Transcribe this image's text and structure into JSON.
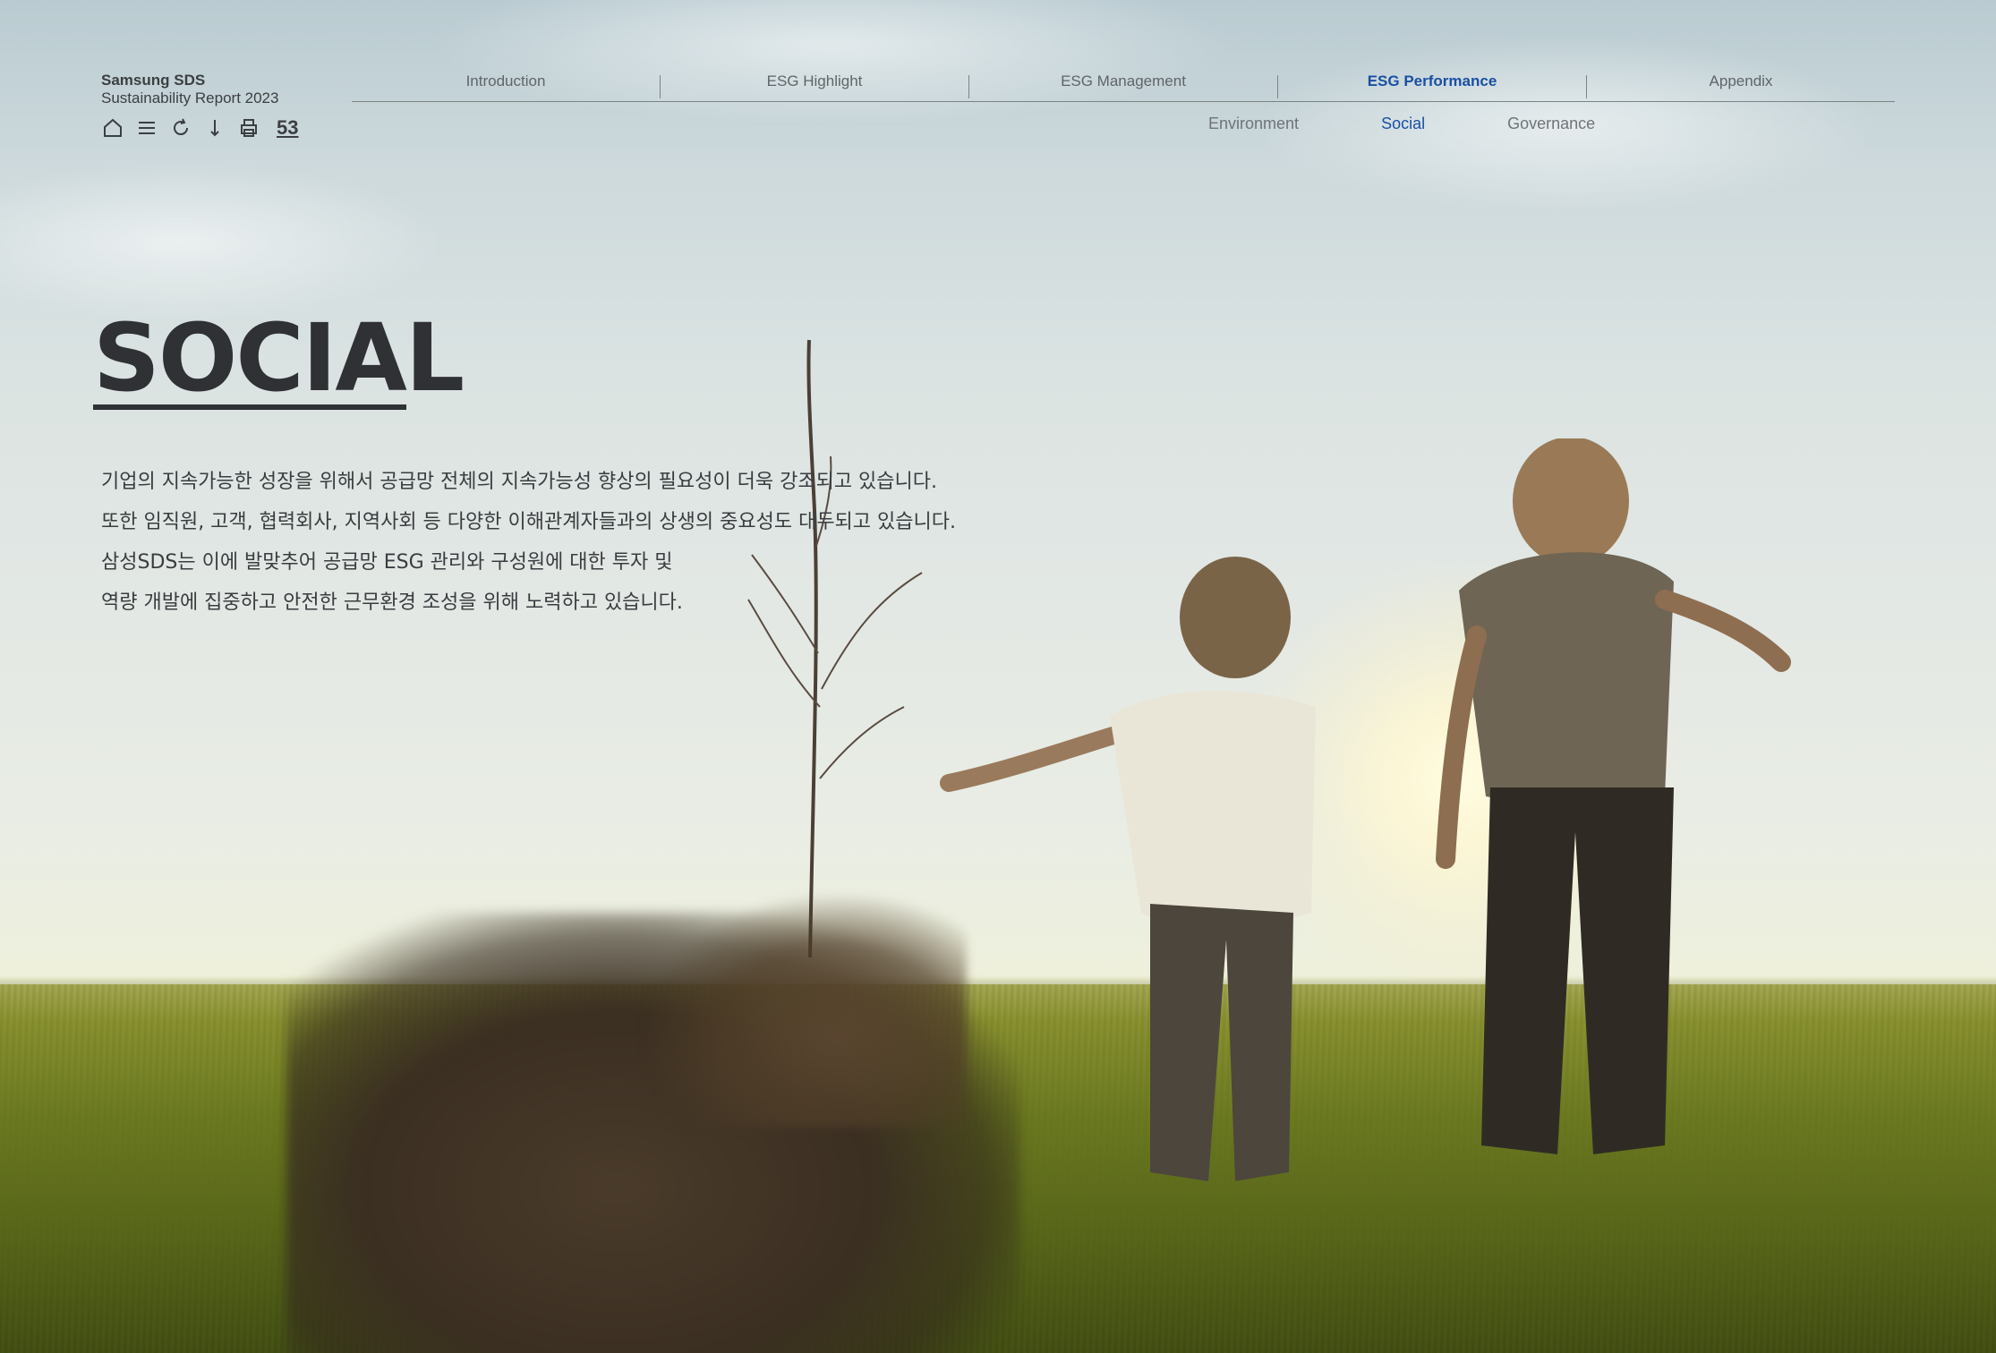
{
  "header": {
    "brand_name": "Samsung SDS",
    "report_title": "Sustainability Report 2023",
    "page_number": "53",
    "tool_icons": [
      "home-icon",
      "menu-icon",
      "back-icon",
      "download-icon",
      "print-icon"
    ]
  },
  "nav": {
    "items": [
      {
        "label": "Introduction",
        "active": false
      },
      {
        "label": "ESG Highlight",
        "active": false
      },
      {
        "label": "ESG Management",
        "active": false
      },
      {
        "label": "ESG Performance",
        "active": true
      },
      {
        "label": "Appendix",
        "active": false
      }
    ],
    "active_color": "#1a4fa3"
  },
  "subnav": {
    "items": [
      {
        "label": "Environment",
        "active": false
      },
      {
        "label": "Social",
        "active": true
      },
      {
        "label": "Governance",
        "active": false
      }
    ]
  },
  "main": {
    "title": "SOCIAL",
    "lines": [
      "기업의 지속가능한 성장을 위해서 공급망 전체의 지속가능성 향상의 필요성이 더욱 강조되고 있습니다.",
      "또한 임직원, 고객, 협력회사, 지역사회 등 다양한 이해관계자들과의 상생의 중요성도 대두되고 있습니다.",
      "삼성SDS는 이에 발맞추어 공급망 ESG 관리와 구성원에 대한 투자 및",
      "역량 개발에 집중하고 안전한 근무환경 조성을 위해 노력하고 있습니다."
    ]
  }
}
